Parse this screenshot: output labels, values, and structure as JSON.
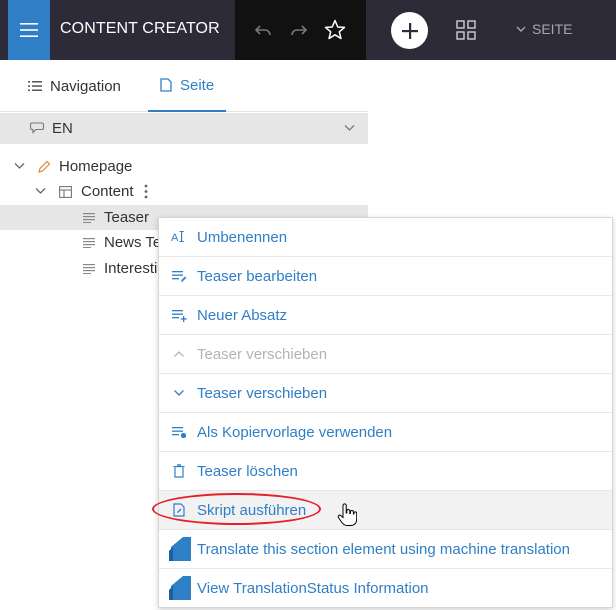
{
  "header": {
    "app_title": "CONTENT CREATOR",
    "page_menu_label": "SEITE"
  },
  "tabs": [
    {
      "label": "Navigation",
      "icon": "list-icon"
    },
    {
      "label": "Seite",
      "icon": "page-icon"
    }
  ],
  "language": {
    "code": "EN"
  },
  "tree": {
    "homepage": "Homepage",
    "content": "Content",
    "children": [
      "Teaser",
      "News Te",
      "Interesti"
    ]
  },
  "context_menu": {
    "items": [
      {
        "label": "Umbenennen",
        "icon": "rename-icon",
        "disabled": false
      },
      {
        "label": "Teaser bearbeiten",
        "icon": "edit-list-icon",
        "disabled": false
      },
      {
        "label": "Neuer Absatz",
        "icon": "add-paragraph-icon",
        "disabled": false
      },
      {
        "label": "Teaser verschieben",
        "icon": "chevron-up-icon",
        "disabled": true
      },
      {
        "label": "Teaser verschieben",
        "icon": "chevron-down-icon",
        "disabled": false
      },
      {
        "label": "Als Kopiervorlage verwenden",
        "icon": "template-icon",
        "disabled": false
      },
      {
        "label": "Teaser löschen",
        "icon": "trash-icon",
        "disabled": false
      },
      {
        "label": "Skript ausführen",
        "icon": "script-icon",
        "disabled": false
      },
      {
        "label": "Translate this section element using machine translation",
        "icon": "translation-icon",
        "disabled": false
      },
      {
        "label": "View TranslationStatus Information",
        "icon": "translation-status-icon",
        "disabled": false
      }
    ]
  },
  "colors": {
    "accent": "#2e7fc6",
    "topbar": "#2d2b37",
    "highlight": "#e4202a"
  }
}
